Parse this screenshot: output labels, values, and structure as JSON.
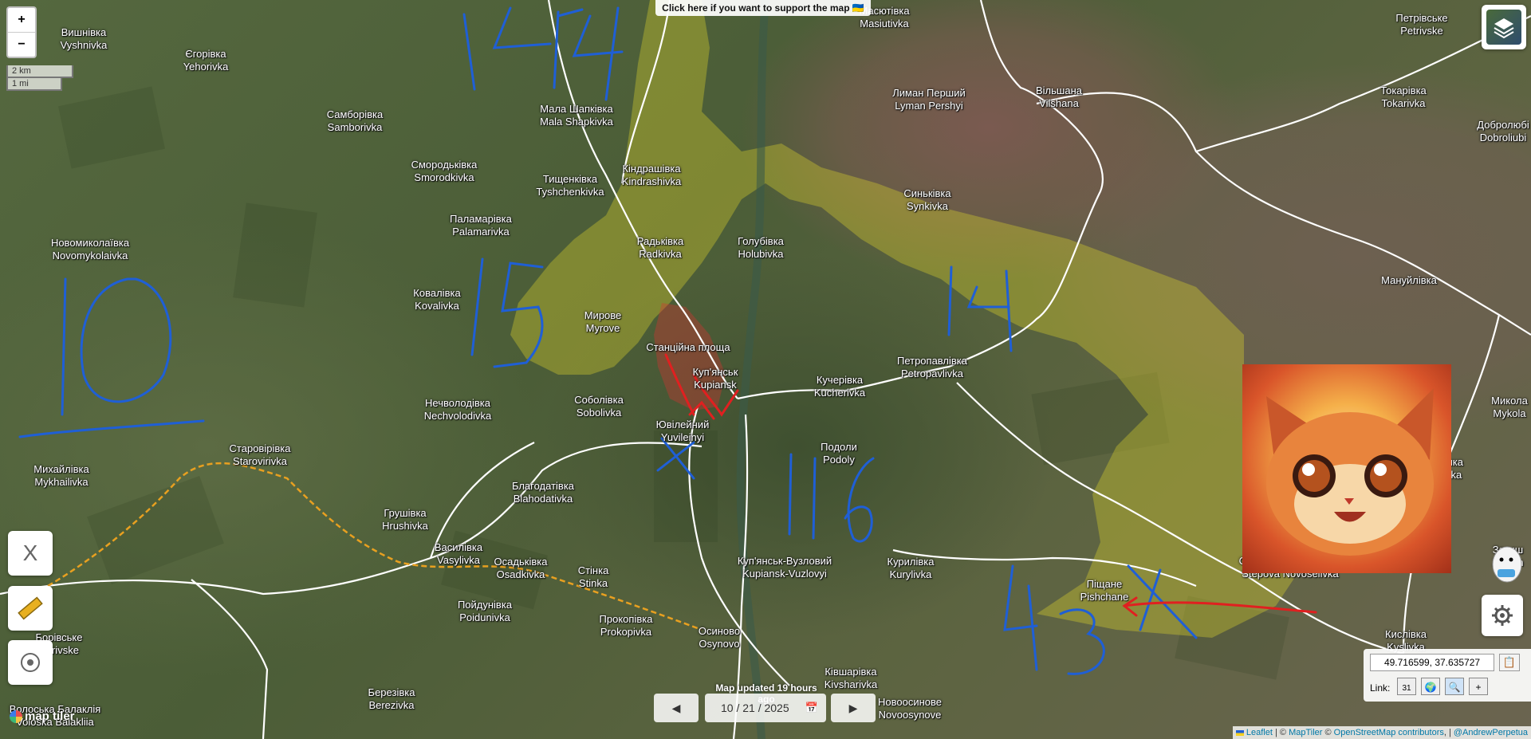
{
  "banner": {
    "text": "Click here if you want to support the map 🇺🇦"
  },
  "zoom": {
    "in": "+",
    "out": "−"
  },
  "scale": {
    "km": "2 km",
    "mi": "1 mi"
  },
  "places": [
    {
      "id": "vyshnivka",
      "local": "Вишнівка",
      "latin": "Vyshnivka"
    },
    {
      "id": "yehorivka",
      "local": "Єгорівка",
      "latin": "Yehorivka"
    },
    {
      "id": "mala-shapkivka",
      "local": "Мала Шапківка",
      "latin": "Mala Shapkivka"
    },
    {
      "id": "masiutivka",
      "local": "Масютівка",
      "latin": "Masiutivka"
    },
    {
      "id": "petrivske",
      "local": "Петрівське",
      "latin": "Petrivske"
    },
    {
      "id": "samborivka",
      "local": "Самборівка",
      "latin": "Samborivka"
    },
    {
      "id": "lyman-pershyi",
      "local": "Лиман Перший",
      "latin": "Lyman Pershyi"
    },
    {
      "id": "vilshana",
      "local": "Вільшана",
      "latin": "Vilshana"
    },
    {
      "id": "tokarivka",
      "local": "Токарівка",
      "latin": "Tokarivka"
    },
    {
      "id": "dobroliubivka",
      "local": "Добролюбі",
      "latin": "Dobroliubi"
    },
    {
      "id": "smorodkivka",
      "local": "Смородьківка",
      "latin": "Smorodkivka"
    },
    {
      "id": "tyshchenkivka",
      "local": "Тищенківка",
      "latin": "Tyshchenkivka"
    },
    {
      "id": "kindrashivka",
      "local": "Кіндрашівка",
      "latin": "Kindrashivka"
    },
    {
      "id": "synkivka",
      "local": "Синьківка",
      "latin": "Synkivka"
    },
    {
      "id": "palamarivka",
      "local": "Паламарівка",
      "latin": "Palamarivka"
    },
    {
      "id": "novomykolaivka",
      "local": "Новомиколаївка",
      "latin": "Novomykolaivka"
    },
    {
      "id": "radkivka",
      "local": "Радьківка",
      "latin": "Radkivka"
    },
    {
      "id": "holubivka",
      "local": "Голубівка",
      "latin": "Holubivka"
    },
    {
      "id": "manuilivka",
      "local": "Мануйлівка",
      "latin": ""
    },
    {
      "id": "kovalivka",
      "local": "Ковалівка",
      "latin": "Kovalivka"
    },
    {
      "id": "myrove",
      "local": "Мирове",
      "latin": "Myrove"
    },
    {
      "id": "stantsiina",
      "local": "Станційна площа",
      "latin": ""
    },
    {
      "id": "kupiansk",
      "local": "Куп'янськ",
      "latin": "Kupiansk"
    },
    {
      "id": "kucherivka",
      "local": "Кучерівка",
      "latin": "Kucherivka"
    },
    {
      "id": "petropavlivka",
      "local": "Петропавлівка",
      "latin": "Petropavlivka"
    },
    {
      "id": "nechvolodivka",
      "local": "Нечволодівка",
      "latin": "Nechvolodivka"
    },
    {
      "id": "sobolivka",
      "local": "Соболівка",
      "latin": "Sobolivka"
    },
    {
      "id": "yuvileinyi",
      "local": "Ювілейний",
      "latin": "Yuvileinyi"
    },
    {
      "id": "mykolaivka",
      "local": "Микола",
      "latin": "Mykola"
    },
    {
      "id": "podoly",
      "local": "Подоли",
      "latin": "Podoly"
    },
    {
      "id": "orlianka",
      "local": "Орлянка",
      "latin": "Orlianka"
    },
    {
      "id": "mykhailivka",
      "local": "Михайлівка",
      "latin": "Mykhailivka"
    },
    {
      "id": "starovirivka",
      "local": "Старовірівка",
      "latin": "Starovirivka"
    },
    {
      "id": "blahodativka",
      "local": "Благодатівка",
      "latin": "Blahodativka"
    },
    {
      "id": "hrushivka",
      "local": "Грушівка",
      "latin": "Hrushivka"
    },
    {
      "id": "vasylivka",
      "local": "Василівка",
      "latin": "Vasylivka"
    },
    {
      "id": "osadkivka",
      "local": "Осадьківка",
      "latin": "Osadkivka"
    },
    {
      "id": "stinka",
      "local": "Стінка",
      "latin": "Stinka"
    },
    {
      "id": "kupiansk-vuzlovyi",
      "local": "Куп'янськ-Вузловий",
      "latin": "Kupiansk-Vuzlovyi"
    },
    {
      "id": "kurylivka",
      "local": "Курилівка",
      "latin": "Kurylivka"
    },
    {
      "id": "stepova-novoselivka",
      "local": "Степова Новоселівка",
      "latin": "Stepova Novoselivka"
    },
    {
      "id": "zatyshshia",
      "local": "Затиш",
      "latin": "Zatysh"
    },
    {
      "id": "pishchane",
      "local": "Піщане",
      "latin": "Pishchane"
    },
    {
      "id": "poidunivka",
      "local": "Пойдунівка",
      "latin": "Poidunivka"
    },
    {
      "id": "prokopivka",
      "local": "Прокопівка",
      "latin": "Prokopivka"
    },
    {
      "id": "osynovo",
      "local": "Осиново",
      "latin": "Osynovo"
    },
    {
      "id": "borivske",
      "local": "Борівське",
      "latin": "Borivske"
    },
    {
      "id": "kyslivka",
      "local": "Кислівка",
      "latin": "Kyslivka"
    },
    {
      "id": "kivsharivka",
      "local": "Ківшарівка",
      "latin": "Kivsharivka"
    },
    {
      "id": "berezivka",
      "local": "Березівка",
      "latin": "Berezivka"
    },
    {
      "id": "novoosynove",
      "local": "Новоосинове",
      "latin": "Novoosynove"
    },
    {
      "id": "voloska-balakliia",
      "local": "Волоська Балаклія",
      "latin": "Voloska Balakliia"
    }
  ],
  "annotations": [
    "14",
    "15",
    "10",
    "14",
    "116",
    "43"
  ],
  "map_updated": "Map updated 19 hours ago",
  "date": "10 / 21 / 2025",
  "coords": "49.716599, 37.635727",
  "link_label": "Link:",
  "tools": {
    "x_label": "X"
  },
  "attribution": {
    "leaflet": "Leaflet",
    "sep1": " | © ",
    "maptiler": "MapTiler",
    "sep2": " © ",
    "osm": "OpenStreetMap contributors",
    "sep3": ", | ",
    "author": "@AndrewPerpetua"
  },
  "logo": "map tiler",
  "colors": {
    "front_red": "#e02020",
    "zone_yellow": "#d4cc2e",
    "annotation_blue": "#1f5fd6",
    "road_white": "#ffffff",
    "rail_orange": "#e8a020"
  }
}
